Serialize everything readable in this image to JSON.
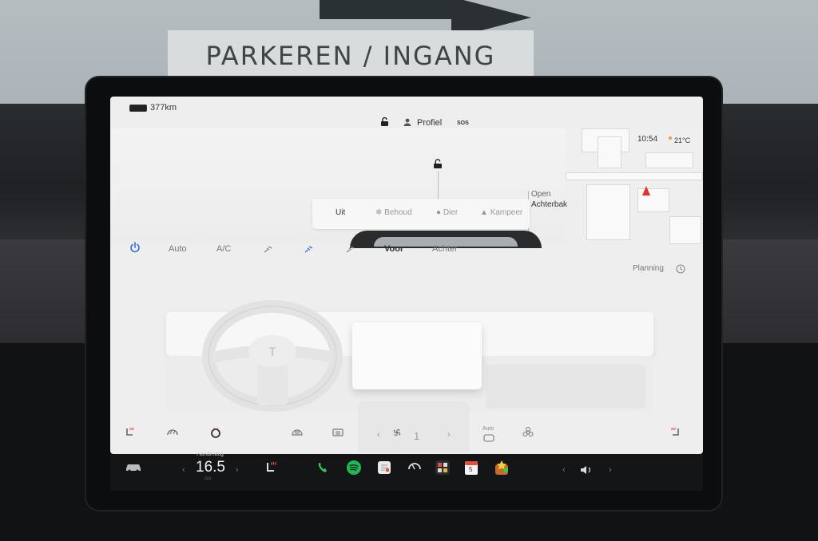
{
  "sign": {
    "text": "PARKEREN / INGANG"
  },
  "status_bar": {
    "range": "377km",
    "profile_label": "Profiel",
    "sos_label": "SOS",
    "time": "10:54",
    "temperature": "21°C"
  },
  "trunk": {
    "state": "Open",
    "name": "Achterbak"
  },
  "camp_modes": {
    "items": [
      {
        "label": "Uit"
      },
      {
        "label": "Behoud"
      },
      {
        "label": "Dier"
      },
      {
        "label": "Kampeer"
      }
    ]
  },
  "climate": {
    "power_icon": "power-icon",
    "auto_label": "Auto",
    "ac_label": "A/C",
    "front_label": "Voor",
    "rear_label": "Achter",
    "planning_label": "Planning",
    "fan_speed": "1",
    "auto_small_label": "Auto",
    "accent_color": "#2f6fe0"
  },
  "taskbar": {
    "temp_mode": "Handmatig",
    "temp_value": "16.5",
    "calendar_day": "5",
    "phone_color": "#2ecc53",
    "spotify_color": "#1db954"
  }
}
